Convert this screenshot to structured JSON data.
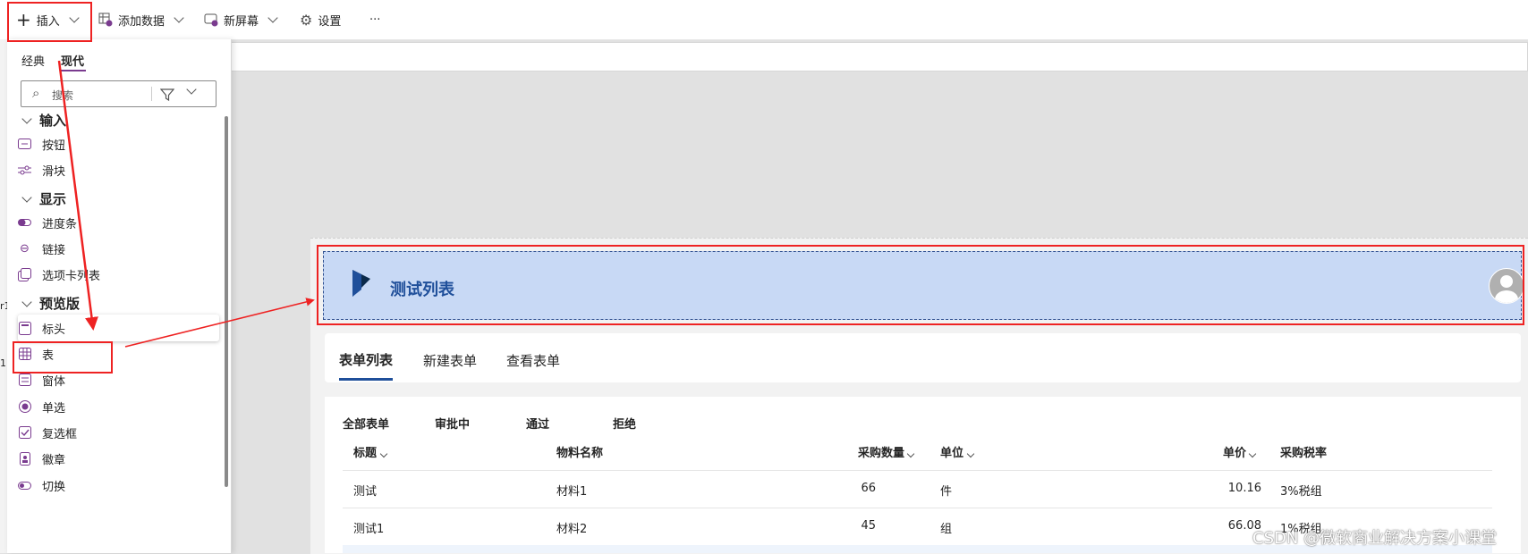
{
  "toolbar": {
    "insert_label": "插入",
    "add_data_label": "添加数据",
    "new_screen_label": "新屏幕",
    "settings_label": "设置",
    "more_label": "···"
  },
  "panel": {
    "tabs": [
      "经典",
      "现代"
    ],
    "active_tab": "现代",
    "search_placeholder": "搜索",
    "sections": [
      {
        "title": "输入",
        "items": [
          "按钮",
          "滑块"
        ]
      },
      {
        "title": "显示",
        "items": [
          "进度条",
          "链接",
          "选项卡列表"
        ]
      },
      {
        "title": "预览版",
        "items": [
          "标头",
          "表",
          "窗体",
          "单选",
          "复选框",
          "徽章",
          "切换"
        ]
      }
    ],
    "highlighted_item": "标头"
  },
  "side_fragment": {
    "a": "r1",
    "b": "1"
  },
  "app": {
    "header_title": "测试列表",
    "tabs": [
      "表单列表",
      "新建表单",
      "查看表单"
    ],
    "active_tab": "表单列表",
    "filters": [
      "全部表单",
      "审批中",
      "通过",
      "拒绝"
    ],
    "columns": [
      "标题",
      "物料名称",
      "采购数量",
      "单位",
      "单价",
      "采购税率"
    ],
    "rows": [
      {
        "title": "测试",
        "material": "材料1",
        "qty": "66",
        "unit": "件",
        "price": "10.16",
        "tax": "3%税组"
      },
      {
        "title": "测试1",
        "material": "材料2",
        "qty": "45",
        "unit": "组",
        "price": "66.08",
        "tax": "1%税组"
      }
    ]
  },
  "colors": {
    "accent": "#7a3b8f",
    "header_bg": "#c8d9f5",
    "title_blue": "#1f4f9a",
    "annotation_red": "#e22222"
  },
  "watermark": "CSDN @微软商业解决方案小课堂"
}
